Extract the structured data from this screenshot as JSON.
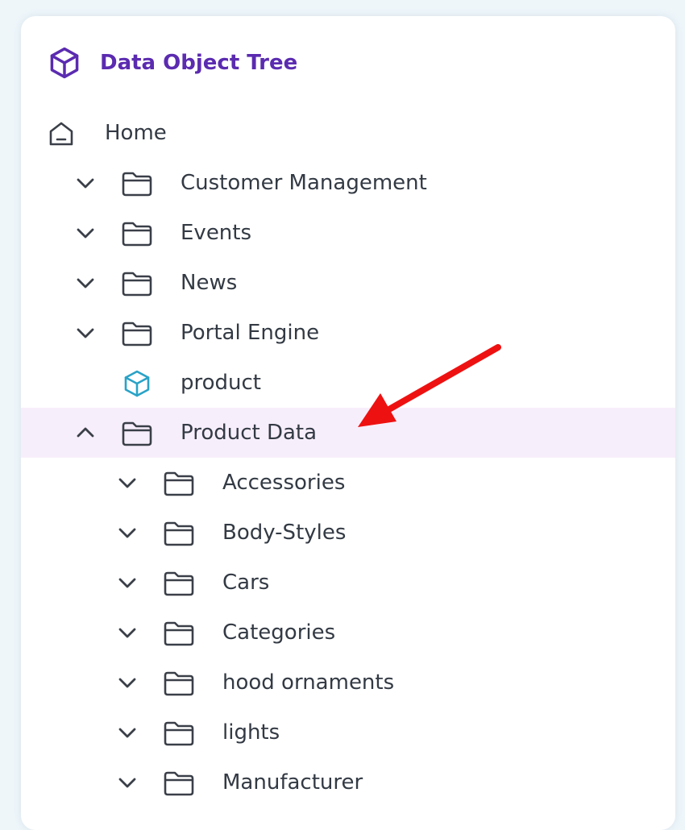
{
  "header": {
    "title": "Data Object Tree",
    "icon": "cube-icon",
    "color": "#5b2bb0"
  },
  "tree": {
    "home": {
      "label": "Home",
      "icon": "home-icon"
    },
    "items": [
      {
        "label": "Customer Management",
        "icon": "folder-icon",
        "chevron": "down",
        "depth": 1
      },
      {
        "label": "Events",
        "icon": "folder-icon",
        "chevron": "down",
        "depth": 1
      },
      {
        "label": "News",
        "icon": "folder-icon",
        "chevron": "down",
        "depth": 1
      },
      {
        "label": "Portal Engine",
        "icon": "folder-icon",
        "chevron": "down",
        "depth": 1
      },
      {
        "label": "product",
        "icon": "cube-icon",
        "chevron": "none",
        "depth": 1
      },
      {
        "label": "Product Data",
        "icon": "folder-icon",
        "chevron": "up",
        "depth": 1,
        "selected": true
      },
      {
        "label": "Accessories",
        "icon": "folder-icon",
        "chevron": "down",
        "depth": 2
      },
      {
        "label": "Body-Styles",
        "icon": "folder-icon",
        "chevron": "down",
        "depth": 2
      },
      {
        "label": "Cars",
        "icon": "folder-icon",
        "chevron": "down",
        "depth": 2
      },
      {
        "label": "Categories",
        "icon": "folder-icon",
        "chevron": "down",
        "depth": 2
      },
      {
        "label": "hood ornaments",
        "icon": "folder-icon",
        "chevron": "down",
        "depth": 2
      },
      {
        "label": "lights",
        "icon": "folder-icon",
        "chevron": "down",
        "depth": 2
      },
      {
        "label": "Manufacturer",
        "icon": "folder-icon",
        "chevron": "down",
        "depth": 2
      }
    ]
  },
  "colors": {
    "selected_bg": "#f7eefb",
    "cube_accent": "#29a3c7",
    "annotation_arrow": "#ee1111"
  }
}
